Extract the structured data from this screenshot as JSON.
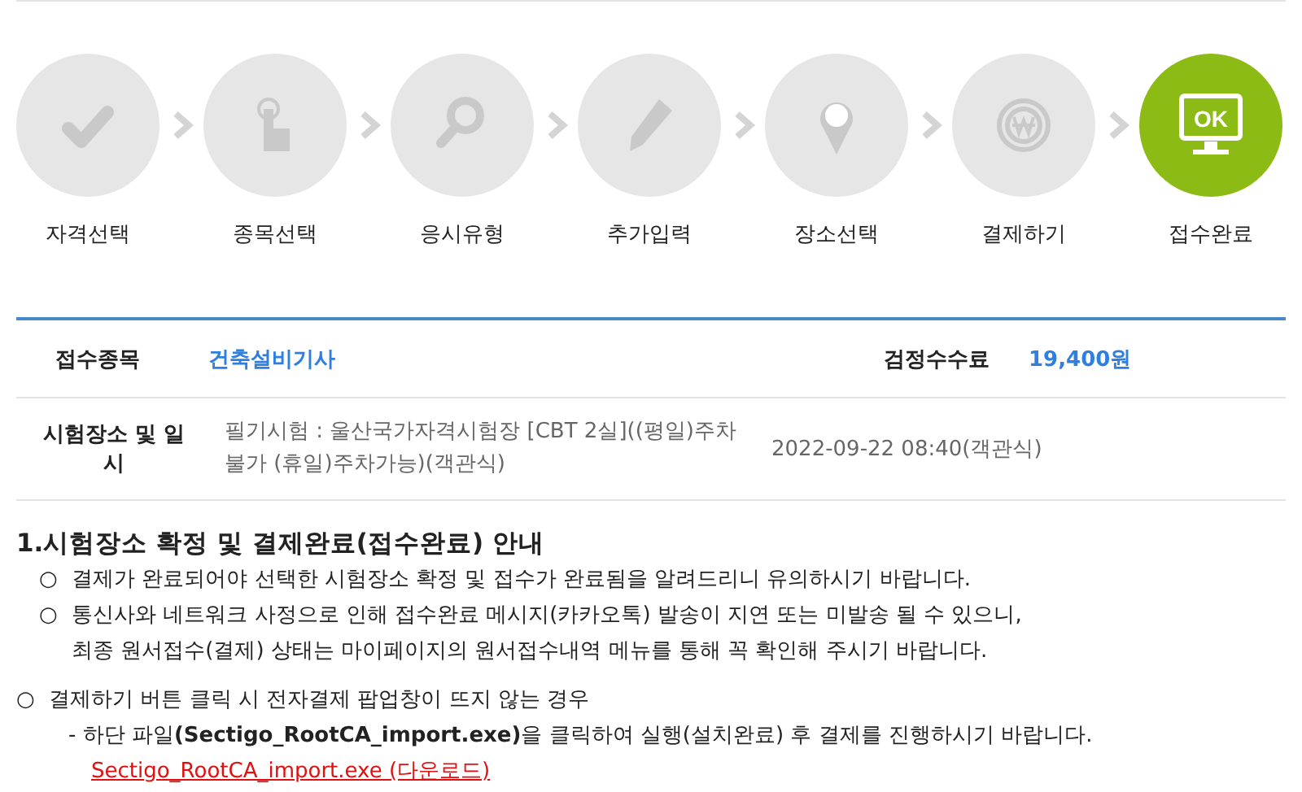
{
  "steps": [
    {
      "label": "자격선택",
      "kind": "check",
      "selected": false
    },
    {
      "label": "종목선택",
      "kind": "hand",
      "selected": false
    },
    {
      "label": "응시유형",
      "kind": "magnifier",
      "selected": false
    },
    {
      "label": "추가입력",
      "kind": "pencil",
      "selected": false
    },
    {
      "label": "장소선택",
      "kind": "pin",
      "selected": false
    },
    {
      "label": "결제하기",
      "kind": "coin",
      "selected": false
    },
    {
      "label": "접수완료",
      "kind": "monitor",
      "screen_text": "OK",
      "selected": true
    }
  ],
  "info": {
    "rows": [
      {
        "cells": [
          {
            "kind": "label",
            "text": "접수종목"
          },
          {
            "kind": "highlight",
            "text": "건축설비기사"
          },
          {
            "kind": "label",
            "text": "검정수수료"
          },
          {
            "kind": "highlight",
            "text": "19,400원"
          }
        ]
      },
      {
        "cells": [
          {
            "kind": "label",
            "text": "시험장소 및 일시"
          },
          {
            "kind": "plain",
            "text": "필기시험 : 울산국가자격시험장 [CBT 2실]((평일)주차불가 (휴일)주차가능)(객관식)"
          },
          {
            "kind": "plain",
            "text": "2022-09-22 08:40(객관식)"
          }
        ]
      }
    ]
  },
  "notice": {
    "heading": "1.시험장소 확정 및 결제완료(접수완료) 안내",
    "items": [
      {
        "kind": "bullet",
        "marker": "○",
        "lines": [
          "결제가 완료되어야 선택한 시험장소 확정 및 접수가 완료됨을 알려드리니 유의하시기 바랍니다."
        ]
      },
      {
        "kind": "bullet",
        "marker": "○",
        "lines": [
          "통신사와 네트워크 사정으로 인해 접수완료 메시지(카카오톡) 발송이 지연 또는 미발송 될 수 있으니,",
          "최종 원서접수(결제) 상태는 마이페이지의 원서접수내역 메뉴를 통해 꼭 확인해 주시기 바랍니다."
        ]
      },
      {
        "kind": "section",
        "marker": "○",
        "lines": [
          "결제하기 버튼 클릭 시 전자결제 팝업창이 뜨지 않는 경우"
        ]
      },
      {
        "kind": "sub",
        "lines": [
          "- 하단 파일**(Sectigo_RootCA_import.exe)**을 클릭하여 실행(설치완료) 후 결제를 진행하시기 바랍니다."
        ]
      },
      {
        "kind": "link",
        "lines": [
          "Sectigo_RootCA_import.exe (다운로드)"
        ]
      }
    ]
  }
}
